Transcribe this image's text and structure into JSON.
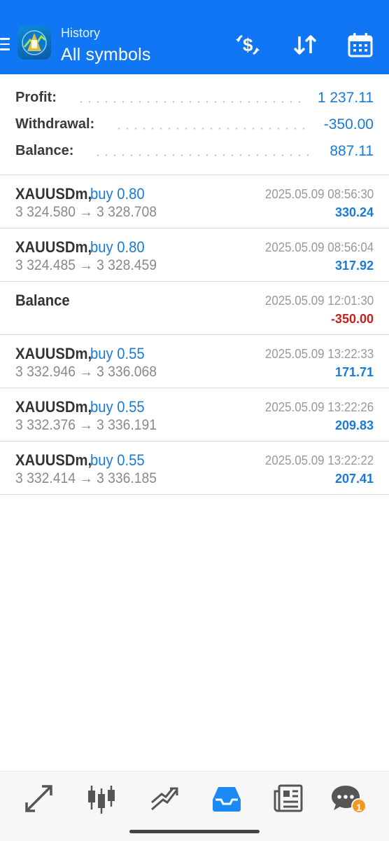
{
  "header": {
    "subtitle": "History",
    "title": "All symbols",
    "icons": [
      "hamburger-icon",
      "metatrader-logo",
      "currency-exchange-icon",
      "sort-icon",
      "calendar-icon"
    ]
  },
  "summary": [
    {
      "label": "Profit:",
      "value": "1 237.11"
    },
    {
      "label": "Withdrawal:",
      "value": "-350.00"
    },
    {
      "label": "Balance:",
      "value": "887.11"
    }
  ],
  "deals": [
    {
      "symbol": "XAUUSDm,",
      "type": "buy 0.80",
      "prices": "3 324.580 → 3 328.708",
      "time": "2025.05.09 08:56:30",
      "profit": "330.24",
      "profit_color": "#1a7ad8"
    },
    {
      "symbol": "XAUUSDm,",
      "type": "buy 0.80",
      "prices": "3 324.485 → 3 328.459",
      "time": "2025.05.09 08:56:04",
      "profit": "317.92",
      "profit_color": "#1a7ad8"
    },
    {
      "symbol": "Balance",
      "type": "",
      "prices": "",
      "time": "2025.05.09 12:01:30",
      "profit": "-350.00",
      "profit_color": "#c62020"
    },
    {
      "symbol": "XAUUSDm,",
      "type": "buy 0.55",
      "prices": "3 332.946 → 3 336.068",
      "time": "2025.05.09 13:22:33",
      "profit": "171.71",
      "profit_color": "#1a7ad8"
    },
    {
      "symbol": "XAUUSDm,",
      "type": "buy 0.55",
      "prices": "3 332.376 → 3 336.191",
      "time": "2025.05.09 13:22:26",
      "profit": "209.83",
      "profit_color": "#1a7ad8"
    },
    {
      "symbol": "XAUUSDm,",
      "type": "buy 0.55",
      "prices": "3 332.414 → 3 336.185",
      "time": "2025.05.09 13:22:22",
      "profit": "207.41",
      "profit_color": "#1a7ad8"
    }
  ],
  "nav": {
    "items": [
      "quotes-icon",
      "chart-icon",
      "trade-icon",
      "history-icon",
      "news-icon",
      "chat-icon"
    ],
    "active": "history-icon",
    "chat_badge": "1"
  },
  "colors": {
    "accent": "#1176f3",
    "positive": "#1a7ad8",
    "negative": "#c62020",
    "active_nav": "#1a88f5"
  }
}
